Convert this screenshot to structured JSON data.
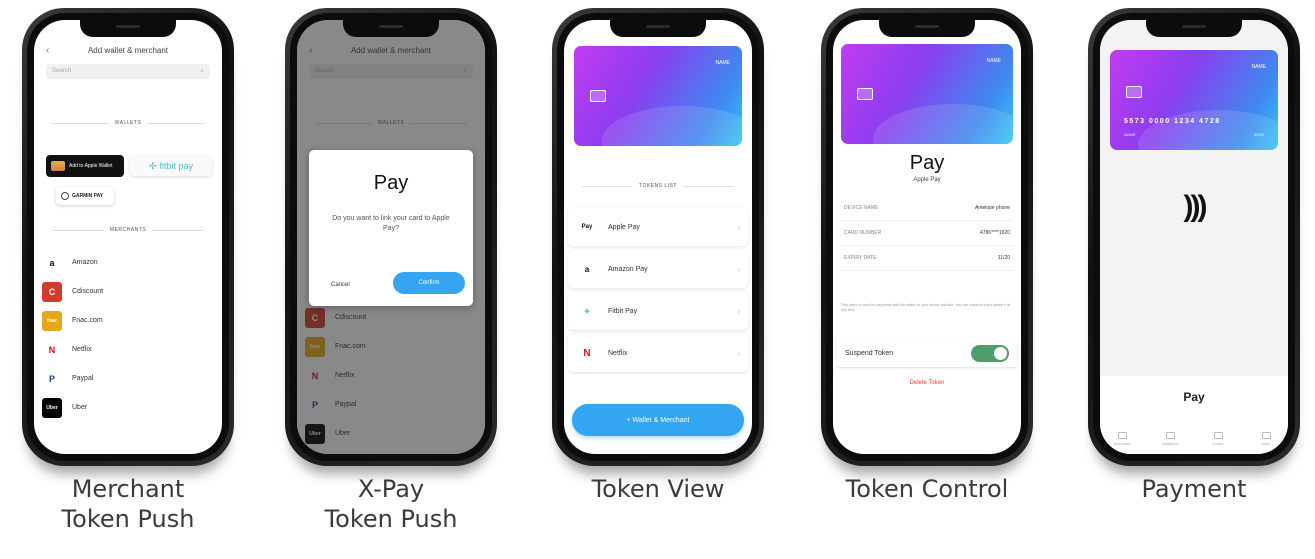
{
  "captions": [
    {
      "line1": "Merchant",
      "line2": "Token Push"
    },
    {
      "line1": "X-Pay",
      "line2": "Token Push"
    },
    {
      "line1": "Token View",
      "line2": ""
    },
    {
      "line1": "Token Control",
      "line2": ""
    },
    {
      "line1": "Payment",
      "line2": ""
    }
  ],
  "merchant_screen": {
    "title": "Add wallet & merchant",
    "back": "‹",
    "search_placeholder": "Search",
    "wallets_heading": "WALLETS",
    "merchants_heading": "MERCHANTS",
    "wallets": {
      "apple": "Add to Apple Wallet",
      "fitbit": "fitbit pay",
      "garmin": "GARMIN PAY"
    },
    "merchants": [
      {
        "name": "Amazon",
        "logo": "a",
        "bg": "#ffffff",
        "fg": "#111111"
      },
      {
        "name": "Cdiscount",
        "logo": "C",
        "bg": "#d33b2c",
        "fg": "#ffffff"
      },
      {
        "name": "Fnac.com",
        "logo": "fnac",
        "bg": "#e7a619",
        "fg": "#ffffff"
      },
      {
        "name": "Netflix",
        "logo": "N",
        "bg": "#ffffff",
        "fg": "#e50914"
      },
      {
        "name": "Paypal",
        "logo": "P",
        "bg": "#ffffff",
        "fg": "#1c3f94"
      },
      {
        "name": "Uber",
        "logo": "Uber",
        "bg": "#000000",
        "fg": "#ffffff"
      }
    ]
  },
  "xpay_screen": {
    "dialog_logo": " Pay",
    "dialog_message": "Do you want to link your card to Apple Pay?",
    "cancel": "Cancel",
    "confirm": "Confirm"
  },
  "token_view_screen": {
    "card_brand": "NAME",
    "tokens_heading": "TOKENS LIST",
    "tokens": [
      {
        "logo": " Pay",
        "name": "Apple Pay",
        "fg": "#111111"
      },
      {
        "logo": "a",
        "name": "Amazon Pay",
        "fg": "#111111"
      },
      {
        "logo": "✦",
        "name": "Fitbit Pay",
        "fg": "#4cc2c4"
      },
      {
        "logo": "N",
        "name": "Netflix",
        "fg": "#e50914"
      }
    ],
    "add_button": "+ Wallet & Merchant"
  },
  "token_control_screen": {
    "card_brand": "NAME",
    "pay_logo": " Pay",
    "pay_sub": "Apple Pay",
    "rows": [
      {
        "label": "DEVICE NAME",
        "value": "Antelope phone"
      },
      {
        "label": "CARD NUMBER",
        "value": "4786****1920"
      },
      {
        "label": "EXPIRY DATE",
        "value": "11/20"
      }
    ],
    "note": "This token is used for payments with the wallet on your device and site. You can suspend it and delete it at any time.",
    "suspend_label": "Suspend Token",
    "delete_label": "Delete Token"
  },
  "payment_screen": {
    "card_brand": "NAME",
    "card_number": "5573 0000 1234 4728",
    "card_holder": "NAME",
    "card_expiry": "09/20",
    "nfc_symbol": ")))",
    "pay_label": "Pay",
    "tabs": [
      "Accounts",
      "Analytics",
      "Cards",
      "More"
    ]
  }
}
